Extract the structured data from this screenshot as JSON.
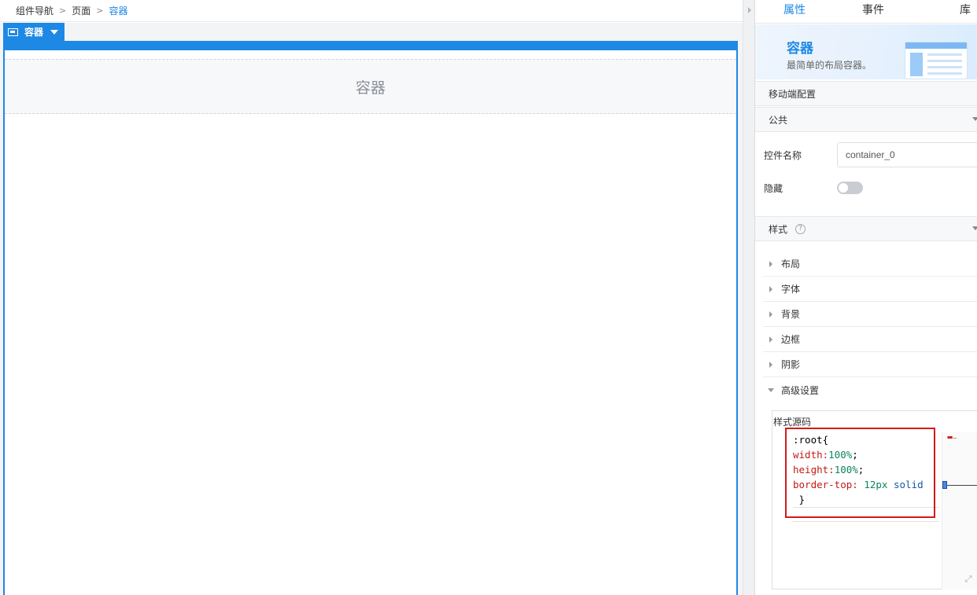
{
  "breadcrumb": {
    "items": [
      "组件导航",
      "页面"
    ],
    "current": "容器"
  },
  "canvas": {
    "container_tag_label": "容器",
    "placeholder_text": "容器"
  },
  "panel": {
    "tabs": [
      "属性",
      "事件",
      "库"
    ],
    "active_tab": "属性",
    "banner": {
      "title": "容器",
      "description": "最简单的布局容器。"
    },
    "sections": {
      "mobile": "移动端配置",
      "common": "公共",
      "style": "样式"
    },
    "fields": {
      "control_name_label": "控件名称",
      "control_name_value": "container_0",
      "hidden_label": "隐藏",
      "hidden_value": false
    },
    "style_items": [
      "布局",
      "字体",
      "背景",
      "边框",
      "阴影",
      "高级设置"
    ],
    "code": {
      "label": "样式源码",
      "line1_selector": ":root{",
      "line2_prop": "width:",
      "line2_val": "100%",
      "line2_end": ";",
      "line3_prop": "height:",
      "line3_val": "100%",
      "line3_end": ";",
      "line4_prop": "border-top:",
      "line4_val": " 12px",
      "line4_kw": " solid",
      "line5": " }",
      "minimap_text": "▪▪ ....."
    }
  },
  "colors": {
    "accent": "#1e88e5",
    "highlight": "#d21a1a"
  }
}
